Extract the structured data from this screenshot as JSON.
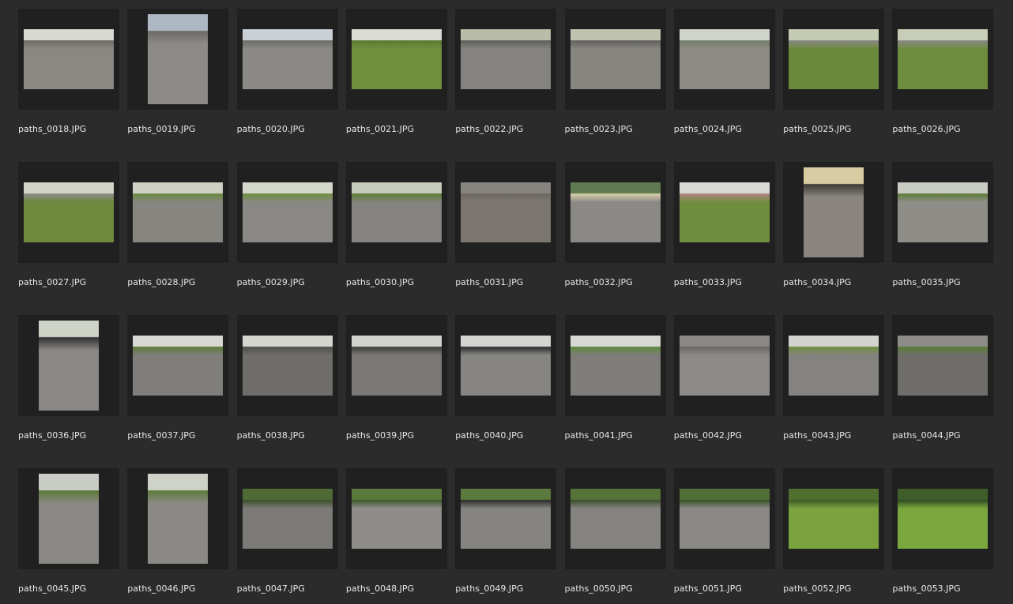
{
  "items": [
    {
      "label": "paths_0018.JPG",
      "orientation": "landscape",
      "sky": "#d9d9d3",
      "ground": "#8a8883",
      "accent": "#6c6a64"
    },
    {
      "label": "paths_0019.JPG",
      "orientation": "portrait",
      "sky": "#aeb8c4",
      "ground": "#8c8a86",
      "accent": "#6b6a66"
    },
    {
      "label": "paths_0020.JPG",
      "orientation": "landscape",
      "sky": "#c9d0d6",
      "ground": "#8a8985",
      "accent": "#6d6c68"
    },
    {
      "label": "paths_0021.JPG",
      "orientation": "landscape",
      "sky": "#dcdcd6",
      "ground": "#6f8f3e",
      "accent": "#5a7a33"
    },
    {
      "label": "paths_0022.JPG",
      "orientation": "landscape",
      "sky": "#b8bda8",
      "ground": "#84837f",
      "accent": "#5f5e5a"
    },
    {
      "label": "paths_0023.JPG",
      "orientation": "landscape",
      "sky": "#bfc3b0",
      "ground": "#86857f",
      "accent": "#62615d"
    },
    {
      "label": "paths_0024.JPG",
      "orientation": "landscape",
      "sky": "#cfd4cd",
      "ground": "#8e8b85",
      "accent": "#70806a"
    },
    {
      "label": "paths_0025.JPG",
      "orientation": "landscape",
      "sky": "#c5ccb3",
      "ground": "#6c8a3b",
      "accent": "#8a8884"
    },
    {
      "label": "paths_0026.JPG",
      "orientation": "landscape",
      "sky": "#c8cdb7",
      "ground": "#6e8c3e",
      "accent": "#8b8986"
    },
    {
      "label": "paths_0027.JPG",
      "orientation": "landscape",
      "sky": "#d2d5c7",
      "ground": "#6d8a3d",
      "accent": "#8c8a87"
    },
    {
      "label": "paths_0028.JPG",
      "orientation": "landscape",
      "sky": "#cfd2c2",
      "ground": "#878580",
      "accent": "#6a8a3d"
    },
    {
      "label": "paths_0029.JPG",
      "orientation": "landscape",
      "sky": "#d4d8cc",
      "ground": "#8a8884",
      "accent": "#6f8f40"
    },
    {
      "label": "paths_0030.JPG",
      "orientation": "landscape",
      "sky": "#c6cbbb",
      "ground": "#85837f",
      "accent": "#5d7d35"
    },
    {
      "label": "paths_0031.JPG",
      "orientation": "landscape",
      "sky": "#87837e",
      "ground": "#7c7670",
      "accent": "#6d6761"
    },
    {
      "label": "paths_0032.JPG",
      "orientation": "landscape",
      "sky": "#5f7a52",
      "ground": "#8b8985",
      "accent": "#d9cfaa"
    },
    {
      "label": "paths_0033.JPG",
      "orientation": "landscape",
      "sky": "#d9d9d6",
      "ground": "#6f8d3f",
      "accent": "#b38686"
    },
    {
      "label": "paths_0034.JPG",
      "orientation": "portrait",
      "sky": "#d8cda2",
      "ground": "#8a8580",
      "accent": "#3c3a37"
    },
    {
      "label": "paths_0035.JPG",
      "orientation": "landscape",
      "sky": "#c9ccc3",
      "ground": "#8f8d88",
      "accent": "#5f7d3a"
    },
    {
      "label": "paths_0036.JPG",
      "orientation": "portrait",
      "sky": "#cfd3c7",
      "ground": "#8a8884",
      "accent": "#2f3133"
    },
    {
      "label": "paths_0037.JPG",
      "orientation": "landscape",
      "sky": "#d7d7d3",
      "ground": "#7f7e7b",
      "accent": "#5f7c3a"
    },
    {
      "label": "paths_0038.JPG",
      "orientation": "landscape",
      "sky": "#d5d5d0",
      "ground": "#6f6d6a",
      "accent": "#4f4e4c"
    },
    {
      "label": "paths_0039.JPG",
      "orientation": "landscape",
      "sky": "#d3d3cf",
      "ground": "#7b7976",
      "accent": "#3f3e3c"
    },
    {
      "label": "paths_0040.JPG",
      "orientation": "landscape",
      "sky": "#d4d4d1",
      "ground": "#878581",
      "accent": "#2b2d31"
    },
    {
      "label": "paths_0041.JPG",
      "orientation": "landscape",
      "sky": "#d7d7d4",
      "ground": "#7f7d7a",
      "accent": "#5d8a3c"
    },
    {
      "label": "paths_0042.JPG",
      "orientation": "landscape",
      "sky": "#8a8884",
      "ground": "#8c8a86",
      "accent": "#6a6864"
    },
    {
      "label": "paths_0043.JPG",
      "orientation": "landscape",
      "sky": "#d2d2ce",
      "ground": "#858380",
      "accent": "#6f8f40"
    },
    {
      "label": "paths_0044.JPG",
      "orientation": "landscape",
      "sky": "#8e8c88",
      "ground": "#6f6d69",
      "accent": "#5a7d36"
    },
    {
      "label": "paths_0045.JPG",
      "orientation": "portrait",
      "sky": "#c9ccc4",
      "ground": "#8a8884",
      "accent": "#5d7a38"
    },
    {
      "label": "paths_0046.JPG",
      "orientation": "portrait",
      "sky": "#cfd2c8",
      "ground": "#8b8985",
      "accent": "#5e7c3a"
    },
    {
      "label": "paths_0047.JPG",
      "orientation": "landscape",
      "sky": "#4f6a34",
      "ground": "#7c7a77",
      "accent": "#3c4f2a"
    },
    {
      "label": "paths_0048.JPG",
      "orientation": "landscape",
      "sky": "#5a7a3b",
      "ground": "#8f8d89",
      "accent": "#3f572b"
    },
    {
      "label": "paths_0049.JPG",
      "orientation": "landscape",
      "sky": "#5b7a3e",
      "ground": "#868480",
      "accent": "#2b2b2b"
    },
    {
      "label": "paths_0050.JPG",
      "orientation": "landscape",
      "sky": "#56733a",
      "ground": "#858380",
      "accent": "#3b4f2a"
    },
    {
      "label": "paths_0051.JPG",
      "orientation": "landscape",
      "sky": "#4f6f36",
      "ground": "#8a8884",
      "accent": "#3a522a"
    },
    {
      "label": "paths_0052.JPG",
      "orientation": "landscape",
      "sky": "#4f6e2f",
      "ground": "#7aa23f",
      "accent": "#3d5a28"
    },
    {
      "label": "paths_0053.JPG",
      "orientation": "landscape",
      "sky": "#3f5e2a",
      "ground": "#7aa83f",
      "accent": "#2f4b22"
    }
  ]
}
